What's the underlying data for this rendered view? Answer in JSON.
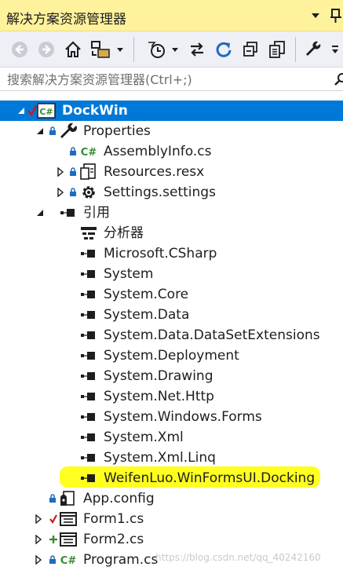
{
  "title": "解决方案资源管理器",
  "search": {
    "placeholder": "搜索解决方案资源管理器(Ctrl+;)"
  },
  "colors": {
    "title_bg": "#fff29d",
    "selection": "#0078d7",
    "highlight": "#ffff20",
    "csharp_green": "#388a34",
    "lock_blue": "#1e6bbf",
    "pending_red": "#c11b1b"
  },
  "toolbar": {
    "icons": [
      "back-icon",
      "forward-icon",
      "home-icon",
      "switch-views-icon",
      "pending-changes-filter-icon",
      "sync-icon",
      "refresh-icon",
      "collapse-all-icon",
      "show-all-files-icon",
      "properties-wrench-icon"
    ]
  },
  "tree": [
    {
      "label": "DockWin"
    },
    {
      "label": "Properties"
    },
    {
      "label": "AssemblyInfo.cs"
    },
    {
      "label": "Resources.resx"
    },
    {
      "label": "Settings.settings"
    },
    {
      "label": "引用"
    },
    {
      "label": "分析器"
    },
    {
      "label": "Microsoft.CSharp"
    },
    {
      "label": "System"
    },
    {
      "label": "System.Core"
    },
    {
      "label": "System.Data"
    },
    {
      "label": "System.Data.DataSetExtensions"
    },
    {
      "label": "System.Deployment"
    },
    {
      "label": "System.Drawing"
    },
    {
      "label": "System.Net.Http"
    },
    {
      "label": "System.Windows.Forms"
    },
    {
      "label": "System.Xml"
    },
    {
      "label": "System.Xml.Linq"
    },
    {
      "label": "WeifenLuo.WinFormsUI.Docking"
    },
    {
      "label": "App.config"
    },
    {
      "label": "Form1.cs"
    },
    {
      "label": "Form2.cs"
    },
    {
      "label": "Program.cs"
    }
  ],
  "watermark": "https://blog.csdn.net/qq_40242160"
}
